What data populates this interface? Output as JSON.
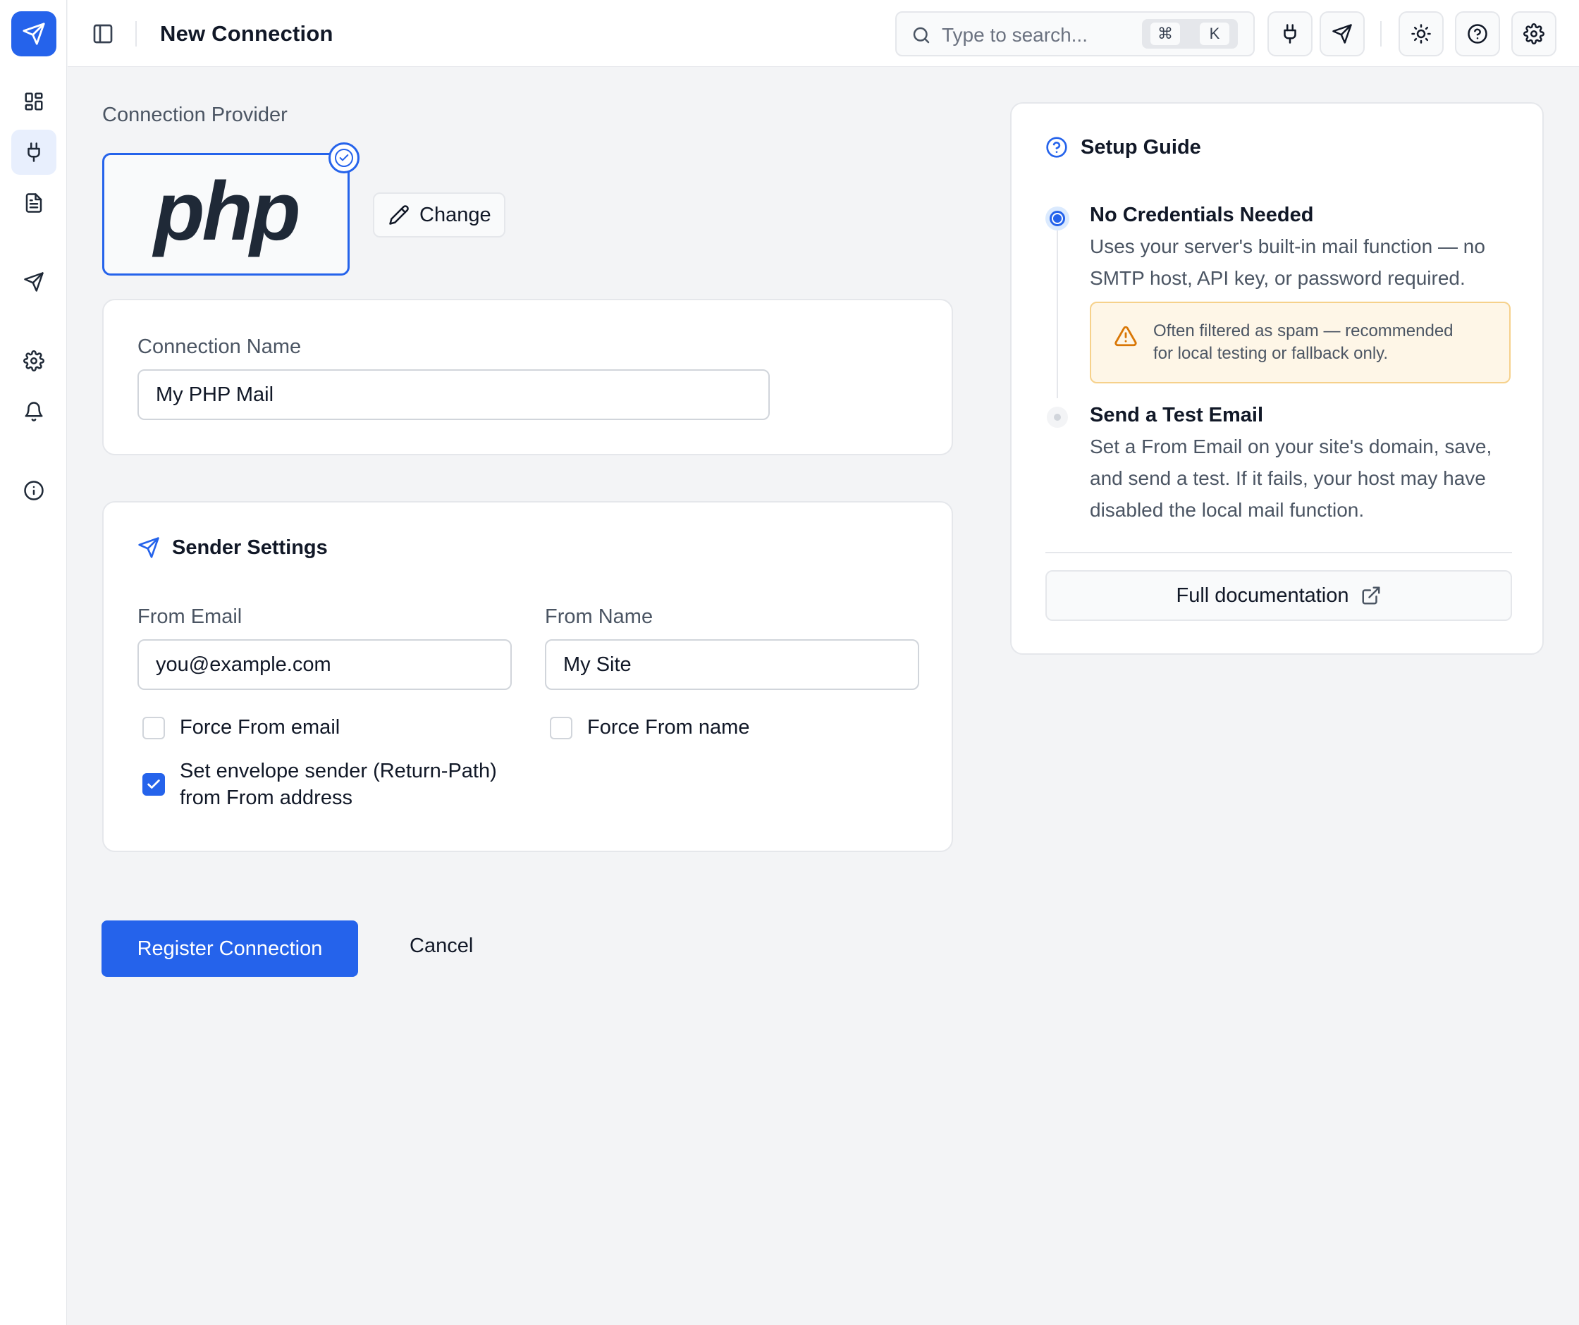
{
  "colors": {
    "accent": "#2563eb",
    "warning": "#d97706",
    "warning_bg": "#fef6e7"
  },
  "sidebar": {
    "brand_icon": "send-icon",
    "items": [
      {
        "icon": "dashboard-icon",
        "active": false
      },
      {
        "icon": "plug-icon",
        "active": true
      },
      {
        "icon": "file-text-icon",
        "active": false
      },
      {
        "icon": "send-icon",
        "active": false
      },
      {
        "icon": "gear-icon",
        "active": false
      },
      {
        "icon": "bell-icon",
        "active": false
      },
      {
        "icon": "info-icon",
        "active": false
      }
    ]
  },
  "header": {
    "title": "New Connection",
    "search": {
      "placeholder": "Type to search...",
      "shortcut_keys": [
        "⌘",
        "K"
      ]
    },
    "actions": [
      "plug-icon",
      "send-icon",
      "sun-icon",
      "help-circle-icon",
      "gear-icon"
    ]
  },
  "provider": {
    "label": "Connection Provider",
    "logo_text": "php",
    "selected": true,
    "change_label": "Change"
  },
  "connection": {
    "name_label": "Connection Name",
    "name_value": "My PHP Mail"
  },
  "sender": {
    "title": "Sender Settings",
    "from_email_label": "From Email",
    "from_email_value": "you@example.com",
    "from_name_label": "From Name",
    "from_name_value": "My Site",
    "force_from_email_label": "Force From email",
    "force_from_email_checked": false,
    "force_from_name_label": "Force From name",
    "force_from_name_checked": false,
    "envelope_label_line1": "Set envelope sender (Return-Path)",
    "envelope_label_line2": "from From address",
    "envelope_checked": true
  },
  "actions": {
    "register_label": "Register Connection",
    "cancel_label": "Cancel"
  },
  "guide": {
    "title": "Setup Guide",
    "steps": [
      {
        "title": "No Credentials Needed",
        "desc_line1": "Uses your server's built-in mail function — no",
        "desc_line2": "SMTP host, API key, or password required.",
        "active": true
      },
      {
        "title": "Send a Test Email",
        "desc_line1": "Set a From Email on your site's domain, save,",
        "desc_line2": "and send a test. If it fails, your host may have",
        "desc_line3": "disabled the local mail function.",
        "active": false
      }
    ],
    "warning_line1": "Often filtered as spam — recommended",
    "warning_line2": "for local testing or fallback only.",
    "doc_button_label": "Full documentation"
  }
}
